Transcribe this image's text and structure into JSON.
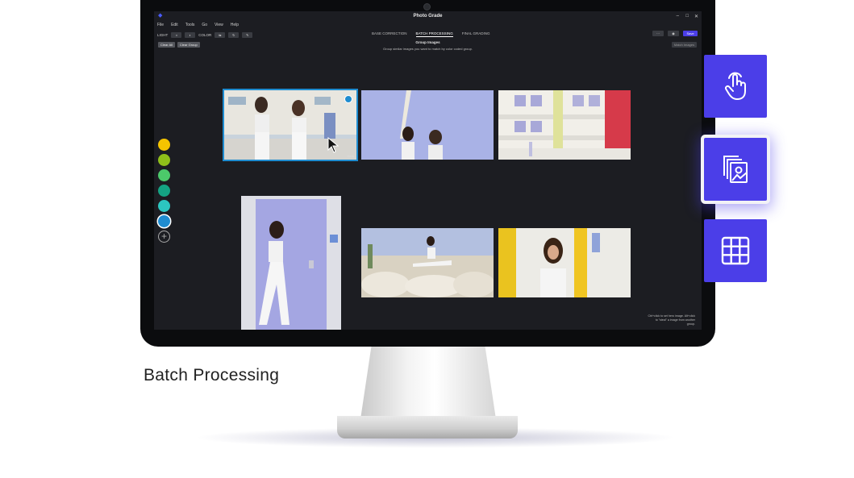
{
  "app": {
    "title": "Photo Grade",
    "logo_icon": "diamond-logo-icon"
  },
  "window_controls": [
    "–",
    "□",
    "✕"
  ],
  "menu": [
    "File",
    "Edit",
    "Tools",
    "Go",
    "View",
    "Help"
  ],
  "toolbar": {
    "light_label": "LIGHT",
    "color_label": "COLOR"
  },
  "tabs": [
    {
      "label": "BASE CORRECTION",
      "active": false
    },
    {
      "label": "BATCH PROCESSING",
      "active": true
    },
    {
      "label": "FINAL GRADING",
      "active": false
    }
  ],
  "right_toolbar": {
    "save_label": "Save"
  },
  "batch": {
    "title": "Group Images",
    "subtitle": "Group similar images you want to match by color coded group.",
    "clear_all": "Clear All",
    "clear_group": "Clear Group",
    "match_images": "Match Images",
    "hero_label": "Hero",
    "hint": "Ctrl+click to set hero image. Alt+click to \"steal\" a image from another group."
  },
  "swatches": [
    "#f5c400",
    "#8fbf1a",
    "#4cc96a",
    "#14a383",
    "#2cc6c0",
    "#1f8cd0"
  ],
  "active_swatch_index": 5,
  "accent_color": "#4b3ee8",
  "caption": "Batch Processing",
  "features": [
    {
      "icon": "touch-hand-icon"
    },
    {
      "icon": "image-stack-icon",
      "active": true
    },
    {
      "icon": "grid-icon"
    }
  ]
}
